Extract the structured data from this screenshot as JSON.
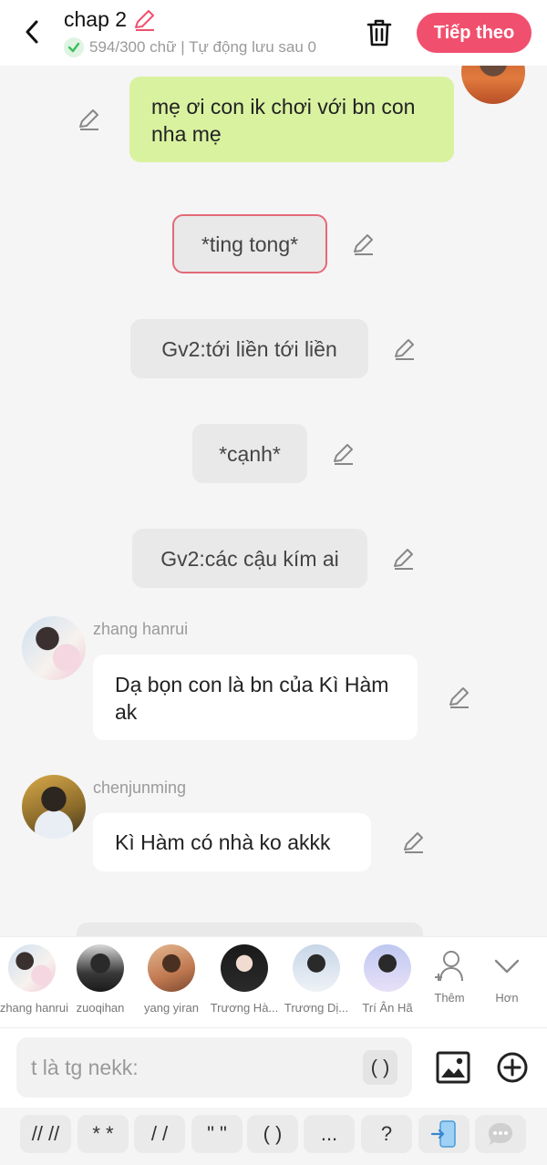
{
  "header": {
    "title": "chap 2",
    "status": "594/300 chữ | Tự động lưu sau 0",
    "next_label": "Tiếp theo"
  },
  "messages": [
    {
      "text": "mẹ ơi con ik chơi với bn con nha mẹ"
    },
    {
      "text": "*ting tong*"
    },
    {
      "text": "Gv2:tới liền tới liền"
    },
    {
      "text": "*cạnh*"
    },
    {
      "text": "Gv2:các cậu kím ai"
    },
    {
      "name": "zhang hanrui",
      "text": "Dạ bọn con là bn của Kì Hàm ak"
    },
    {
      "name": "chenjunming",
      "text": "Kì Hàm có nhà ko akkk"
    }
  ],
  "characters": [
    {
      "name": "zhang hanrui"
    },
    {
      "name": "zuoqihan"
    },
    {
      "name": "yang yiran"
    },
    {
      "name": "Trương Hà..."
    },
    {
      "name": "Trương Dị..."
    },
    {
      "name": "Trí Ân Hã"
    }
  ],
  "strip_actions": {
    "add_label": "Thêm",
    "more_label": "Hơn"
  },
  "input": {
    "value": "t là tg nekk:",
    "paren_label": "( )"
  },
  "symbols": [
    "// //",
    "* *",
    "/ /",
    "\" \"",
    "( )",
    "..."
  ],
  "symbol_q": "?",
  "colors": {
    "accent": "#f0506e",
    "user_bubble": "#d9f2a0",
    "narration_bubble": "#e9e9e9",
    "check_green": "#3cbf5a"
  }
}
